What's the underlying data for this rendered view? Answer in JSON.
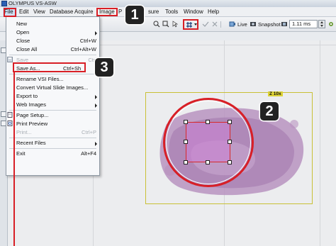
{
  "window": {
    "title": "OLYMPUS VS-ASW"
  },
  "menubar": {
    "items": [
      "File",
      "Edit",
      "View",
      "Database",
      "Acquire",
      "Image",
      "P",
      "sure",
      "Tools",
      "Window",
      "Help"
    ]
  },
  "toolbar": {
    "live_label": "Live",
    "snapshot_label": "Snapshot",
    "exposure_value": "1.11 ms"
  },
  "file_menu": {
    "items": [
      {
        "label": "New",
        "shortcut": "",
        "submenu": false,
        "disabled": false
      },
      {
        "label": "Open",
        "shortcut": "",
        "submenu": true,
        "disabled": false
      },
      {
        "label": "Close",
        "shortcut": "Ctrl+W",
        "submenu": false,
        "disabled": false
      },
      {
        "label": "Close All",
        "shortcut": "Ctrl+Alt+W",
        "submenu": false,
        "disabled": false
      },
      {
        "label": "Save",
        "shortcut": "Ctrl",
        "submenu": false,
        "disabled": true
      },
      {
        "label": "Save As...",
        "shortcut": "Ctrl+Sh",
        "submenu": false,
        "disabled": false
      },
      {
        "label": "Rename VSI Files...",
        "shortcut": "",
        "submenu": false,
        "disabled": false
      },
      {
        "label": "Convert Virtual Slide Images...",
        "shortcut": "",
        "submenu": false,
        "disabled": false
      },
      {
        "label": "Export to",
        "shortcut": "",
        "submenu": true,
        "disabled": false
      },
      {
        "label": "Web Images",
        "shortcut": "",
        "submenu": true,
        "disabled": false
      },
      {
        "label": "Page Setup...",
        "shortcut": "",
        "submenu": false,
        "disabled": false
      },
      {
        "label": "Print Preview",
        "shortcut": "",
        "submenu": false,
        "disabled": false
      },
      {
        "label": "Print...",
        "shortcut": "Ctrl+P",
        "submenu": false,
        "disabled": true
      },
      {
        "label": "Recent Files",
        "shortcut": "",
        "submenu": true,
        "disabled": false
      },
      {
        "label": "Exit",
        "shortcut": "Alt+F4",
        "submenu": false,
        "disabled": false
      }
    ]
  },
  "viewer": {
    "zoom_label": "Z 10x"
  },
  "callouts": [
    "1",
    "2",
    "3"
  ],
  "colors": {
    "callout_red": "#d81f26",
    "selection_fill": "#c982d2",
    "overview_frame": "#c9c035"
  }
}
